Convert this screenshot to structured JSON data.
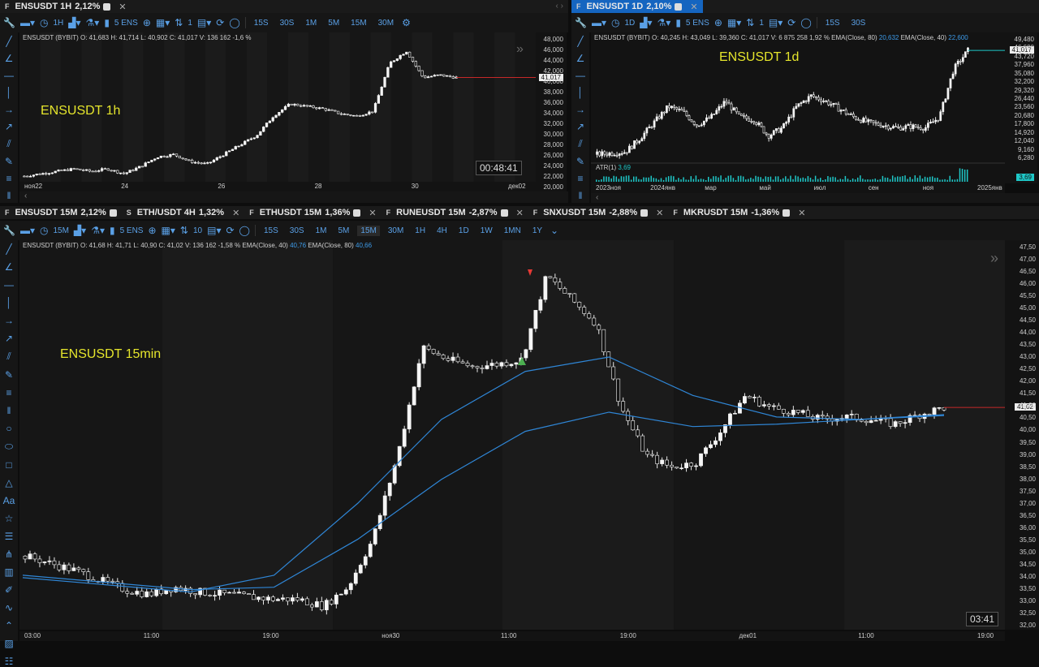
{
  "panels": {
    "p1": {
      "tab": {
        "tag": "F",
        "label": "ENSUSDT 1H",
        "change": "2,12%"
      },
      "toolbar": {
        "interval": "1H",
        "count": "1",
        "symbol": "5 ENS"
      },
      "timeframes": [
        "15S",
        "30S",
        "1M",
        "5M",
        "15M",
        "30M"
      ],
      "info": "ENSUSDT (BYBIT) O: 41,683 H: 41,714 L: 40,902 C: 41,017 V: 136 162 -1,6 %",
      "overlay": "ENSUSDT 1h",
      "timer": "00:48:41",
      "last_price": "41,017",
      "y_ticks": [
        "48,000",
        "46,000",
        "44,000",
        "42,000",
        "40,000",
        "38,000",
        "36,000",
        "34,000",
        "32,000",
        "30,000",
        "28,000",
        "26,000",
        "24,000",
        "22,000",
        "20,000"
      ],
      "x_ticks": [
        "ноя22",
        "24",
        "26",
        "28",
        "30",
        "дек02"
      ]
    },
    "p2": {
      "tab": {
        "tag": "F",
        "label": "ENSUSDT 1D",
        "change": "2,10%"
      },
      "toolbar": {
        "interval": "1D",
        "count": "1",
        "symbol": "5 ENS"
      },
      "timeframes": [
        "15S",
        "30S"
      ],
      "info_prefix": "ENSUSDT (BYBIT) O: 40,245 H: 43,049 L: 39,360 C: 41,017 V: 6 875 258 1,92 % EMA(Close, 80)",
      "ema80": "20,632",
      "ema40_label": "EMA(Close, 40)",
      "ema40": "22,600",
      "overlay": "ENSUSDT 1d",
      "last_price": "41,017",
      "atr_label": "ATR(1)",
      "atr_value": "3,69",
      "y_ticks": [
        "49,480",
        "46,600",
        "43,720",
        "37,960",
        "35,080",
        "32,200",
        "29,320",
        "26,440",
        "23,560",
        "20,680",
        "17,800",
        "14,920",
        "12,040",
        "9,160",
        "6,280"
      ],
      "x_ticks": [
        "2023ноя",
        "2024янв",
        "мар",
        "май",
        "июл",
        "сен",
        "ноя",
        "2025янв"
      ]
    },
    "p3": {
      "tab": {
        "tag": "F",
        "label": "ENSUSDT 15M",
        "change": "2,12%"
      },
      "toolbar": {
        "interval": "15M",
        "count": "10",
        "symbol": "5 ENS"
      },
      "timeframes": [
        "15S",
        "30S",
        "1M",
        "5M",
        "15M",
        "30M",
        "1H",
        "4H",
        "1D",
        "1W",
        "1MN",
        "1Y"
      ],
      "selected_timeframe": "15M",
      "info_prefix": "ENSUSDT (BYBIT) O: 41,68 H: 41,71 L: 40,90 C: 41,02 V: 136 162 -1,58 % EMA(Close, 40)",
      "ema40": "40,76",
      "ema80_label": "EMA(Close, 80)",
      "ema80": "40,66",
      "overlay": "ENSUSDT 15min",
      "timer": "03:41",
      "last_price": "41,02",
      "y_ticks": [
        "47,50",
        "47,00",
        "46,50",
        "46,00",
        "45,50",
        "45,00",
        "44,50",
        "44,00",
        "43,50",
        "43,00",
        "42,50",
        "42,00",
        "41,50",
        "41,00",
        "40,50",
        "40,00",
        "39,50",
        "39,00",
        "38,50",
        "38,00",
        "37,50",
        "37,00",
        "36,50",
        "36,00",
        "35,50",
        "35,00",
        "34,50",
        "34,00",
        "33,50",
        "33,00",
        "32,50",
        "32,00"
      ],
      "x_ticks": [
        "03:00",
        "11:00",
        "19:00",
        "ноя30",
        "11:00",
        "19:00",
        "дек01",
        "11:00",
        "19:00"
      ]
    }
  },
  "other_tabs": [
    {
      "tag": "S",
      "label": "ETH/USDT 4H",
      "change": "1,32%"
    },
    {
      "tag": "F",
      "label": "ETHUSDT 15M",
      "change": "1,36%"
    },
    {
      "tag": "F",
      "label": "RUNEUSDT 15M",
      "change": "-2,87%"
    },
    {
      "tag": "F",
      "label": "SNXUSDT 15M",
      "change": "-2,88%"
    },
    {
      "tag": "F",
      "label": "MKRUSDT 15M",
      "change": "-1,36%"
    }
  ],
  "colors": {
    "accent": "#1565c0",
    "ema": "#2f86d6",
    "last_price_line": "#c62828",
    "atr": "#1ec8c8",
    "overlay_text": "#e5e52c",
    "buy_marker": "#4caf50",
    "sell_marker": "#e53935"
  },
  "chart_data": [
    {
      "type": "candlestick",
      "title": "ENSUSDT 1h",
      "ylim": [
        20,
        48
      ],
      "series": [
        {
          "values": [
            20.5,
            21,
            21.5,
            22,
            21.5,
            22,
            21,
            22.5,
            24.5,
            25,
            23.5,
            23,
            25,
            27,
            29,
            33,
            35.5,
            35,
            34.5,
            33.5,
            33,
            34,
            44,
            46.5,
            41,
            41.5,
            41
          ]
        }
      ]
    },
    {
      "type": "candlestick",
      "title": "ENSUSDT 1d",
      "ylim": [
        6.28,
        49.48
      ],
      "series": [
        {
          "values": [
            8,
            8.5,
            9,
            14,
            20,
            26,
            24,
            19,
            22,
            28,
            22,
            21,
            15,
            18,
            26,
            30,
            28,
            25,
            22,
            20,
            19,
            18,
            18.5,
            18,
            22,
            40,
            47
          ]
        }
      ]
    },
    {
      "type": "candlestick",
      "title": "ENSUSDT 15min",
      "ylim": [
        32,
        47.5
      ],
      "series": [
        {
          "values": [
            34.8,
            34.5,
            34.2,
            33.8,
            33.4,
            33.2,
            33.5,
            33.3,
            33.2,
            33.1,
            33.0,
            33.0,
            32.7,
            33.5,
            35.5,
            39.0,
            43.5,
            43.0,
            42.7,
            42.8,
            43.0,
            46.5,
            45.5,
            44.5,
            41.0,
            39.0,
            38.5,
            38.7,
            40.0,
            41.5,
            41.0,
            40.8,
            40.5,
            40.6,
            40.5,
            40.3,
            40.7,
            41.0
          ]
        }
      ],
      "ema40": [
        33.9,
        33.6,
        33.3,
        34.0,
        37.0,
        40.5,
        42.5,
        43.1,
        41.5,
        40.6,
        40.5,
        40.7
      ],
      "ema80": [
        34.0,
        33.7,
        33.4,
        33.5,
        35.5,
        38.0,
        40.0,
        40.8,
        40.2,
        40.3,
        40.5,
        40.66
      ]
    }
  ]
}
